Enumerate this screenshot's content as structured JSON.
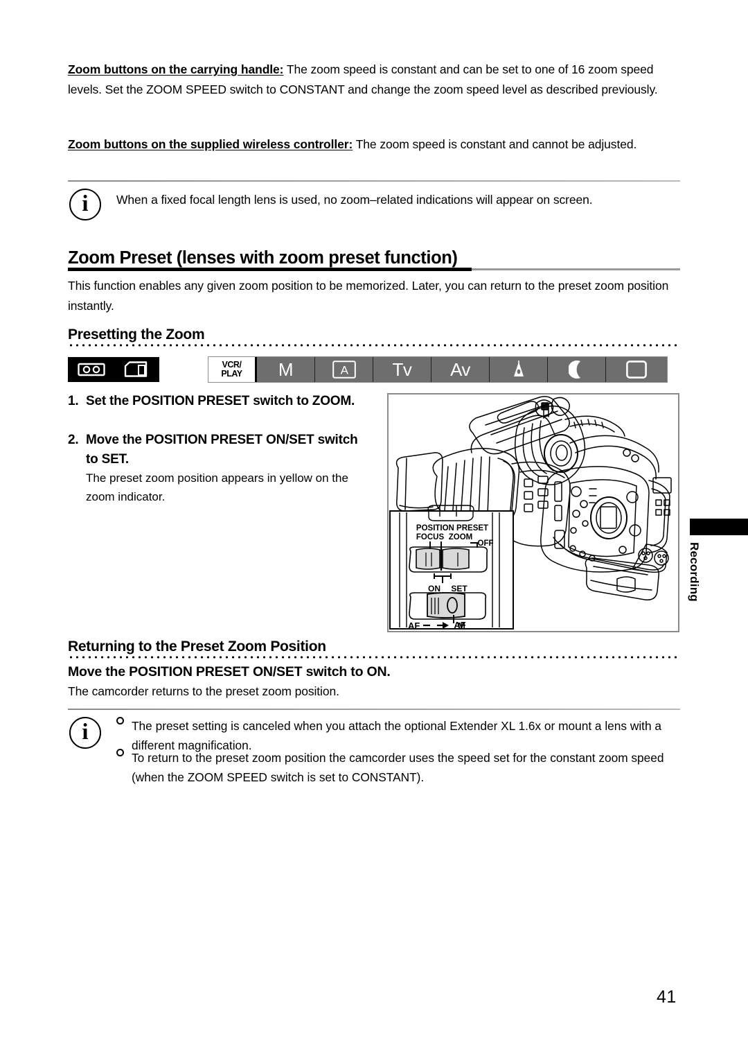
{
  "document": {
    "page_number": "41",
    "side_tab_label": "Recording"
  },
  "paragraphs": {
    "handle_lead": "Zoom buttons on the carrying handle:",
    "handle_body": " The zoom speed is constant and can be set to one of 16 zoom speed levels. Set the ZOOM SPEED switch to CONSTANT and change the zoom speed level as described previously.",
    "wireless_lead": "Zoom buttons on the supplied wireless controller:",
    "wireless_body": " The zoom speed is constant and cannot be adjusted.",
    "note_fixed_focal": "When a fixed focal length lens is used, no zoom–related indications will appear on screen.",
    "intro": "This function enables any given zoom position to be memorized. Later, you can return to the preset zoom position instantly.",
    "returning_action": "Move the POSITION PRESET ON/SET switch to ON.",
    "returning_body": "The camcorder returns to the preset zoom position."
  },
  "headings": {
    "zoom_preset": "Zoom Preset (lenses with zoom preset function)",
    "presetting": "Presetting the Zoom",
    "returning": "Returning to the Preset Zoom Position"
  },
  "mode_bar": {
    "media": [
      {
        "name": "tape-icon",
        "label": "tape"
      },
      {
        "name": "card-icon",
        "label": "card"
      }
    ],
    "modes": [
      {
        "name": "vcr-play",
        "label": "VCR/\nPLAY",
        "line1": "VCR/",
        "line2": "PLAY",
        "active": false
      },
      {
        "name": "manual",
        "label": "M",
        "active": true
      },
      {
        "name": "auto",
        "label": "A",
        "active": true
      },
      {
        "name": "tv",
        "label": "Tv",
        "active": true
      },
      {
        "name": "av",
        "label": "Av",
        "active": true
      },
      {
        "name": "spotlight",
        "label": "spotlight-icon",
        "active": true
      },
      {
        "name": "night",
        "label": "moon-icon",
        "active": true
      },
      {
        "name": "frame",
        "label": "frame-icon",
        "active": true
      }
    ]
  },
  "steps": [
    {
      "number": "1.",
      "text": "Set the POSITION PRESET switch to ZOOM."
    },
    {
      "number": "2.",
      "text": "Move the POSITION PRESET ON/SET switch to SET.",
      "body": "The preset zoom position appears in yellow on the zoom indicator."
    }
  ],
  "illustration": {
    "callout_labels": {
      "position_preset": "POSITION PRESET",
      "focus": "FOCUS",
      "zoom": "ZOOM",
      "off": "OFF",
      "on": "ON",
      "set": "SET",
      "af_arrow": "AF",
      "af": "AF",
      "m": "M"
    }
  },
  "notes": [
    "The preset setting is canceled when you attach the optional Extender XL 1.6x or mount a lens with a different magnification.",
    "To return to the preset zoom position the camcorder uses the speed set for the constant zoom speed (when the ZOOM SPEED switch is set to CONSTANT)."
  ],
  "colors": {
    "mode_inactive_bg": "#ffffff",
    "mode_active_bg": "#6e6e6e",
    "rule_gray": "#9a9a9a",
    "frame_gray": "#8a8a8a"
  }
}
